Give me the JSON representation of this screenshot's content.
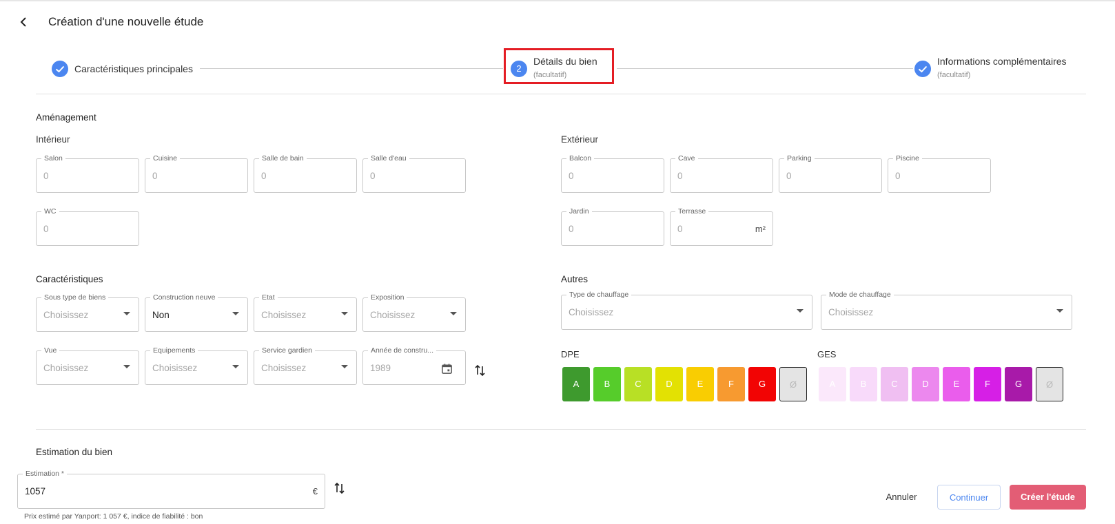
{
  "header": {
    "title": "Création d'une nouvelle étude"
  },
  "stepper": {
    "steps": [
      {
        "label": "Caractéristiques principales",
        "sub": "",
        "state": "done"
      },
      {
        "label": "Détails du bien",
        "sub": "(facultatif)",
        "number": "2",
        "state": "active"
      },
      {
        "label": "Informations complémentaires",
        "sub": "(facultatif)",
        "state": "done"
      }
    ]
  },
  "amenagement": {
    "title": "Aménagement",
    "interieur": {
      "title": "Intérieur",
      "fields": [
        {
          "label": "Salon",
          "value": "0"
        },
        {
          "label": "Cuisine",
          "value": "0"
        },
        {
          "label": "Salle de bain",
          "value": "0"
        },
        {
          "label": "Salle d'eau",
          "value": "0"
        },
        {
          "label": "WC",
          "value": "0"
        }
      ]
    },
    "exterieur": {
      "title": "Extérieur",
      "fields": [
        {
          "label": "Balcon",
          "value": "0"
        },
        {
          "label": "Cave",
          "value": "0"
        },
        {
          "label": "Parking",
          "value": "0"
        },
        {
          "label": "Piscine",
          "value": "0"
        },
        {
          "label": "Jardin",
          "value": "0"
        },
        {
          "label": "Terrasse",
          "value": "0",
          "unit": "m²"
        }
      ]
    }
  },
  "caracteristiques": {
    "title": "Caractéristiques",
    "fields": [
      {
        "label": "Sous type de biens",
        "value": "Choisissez"
      },
      {
        "label": "Construction neuve",
        "value": "Non"
      },
      {
        "label": "Etat",
        "value": "Choisissez"
      },
      {
        "label": "Exposition",
        "value": "Choisissez"
      },
      {
        "label": "Vue",
        "value": "Choisissez"
      },
      {
        "label": "Equipements",
        "value": "Choisissez"
      },
      {
        "label": "Service gardien",
        "value": "Choisissez"
      },
      {
        "label": "Année de constru...",
        "value": "1989"
      }
    ]
  },
  "autres": {
    "title": "Autres",
    "fields": [
      {
        "label": "Type de chauffage",
        "value": "Choisissez"
      },
      {
        "label": "Mode de chauffage",
        "value": "Choisissez"
      }
    ],
    "dpe": {
      "label": "DPE",
      "buttons": [
        {
          "letter": "A",
          "color": "#3e9a2e"
        },
        {
          "letter": "B",
          "color": "#56cc2b"
        },
        {
          "letter": "C",
          "color": "#b8e025"
        },
        {
          "letter": "D",
          "color": "#e3e103"
        },
        {
          "letter": "E",
          "color": "#f9cd02"
        },
        {
          "letter": "F",
          "color": "#f79a30"
        },
        {
          "letter": "G",
          "color": "#f20404"
        },
        {
          "letter": "Ø",
          "color": "#e4e4e4"
        }
      ]
    },
    "ges": {
      "label": "GES",
      "buttons": [
        {
          "letter": "A",
          "color": "#fbe8fb"
        },
        {
          "letter": "B",
          "color": "#f8dafa"
        },
        {
          "letter": "C",
          "color": "#f0bff2"
        },
        {
          "letter": "D",
          "color": "#ec88ee"
        },
        {
          "letter": "E",
          "color": "#ea5dec"
        },
        {
          "letter": "F",
          "color": "#d61fe6"
        },
        {
          "letter": "G",
          "color": "#a81aa9"
        },
        {
          "letter": "Ø",
          "color": "#e4e4e4"
        }
      ]
    }
  },
  "estimation": {
    "title": "Estimation du bien",
    "label": "Estimation *",
    "value": "1057",
    "unit": "€",
    "hint": "Prix estimé par Yanport: 1 057 €, indice de fiabilité : bon"
  },
  "actions": {
    "cancel": "Annuler",
    "continue": "Continuer",
    "create": "Créer l'étude"
  },
  "colors": {
    "accent": "#4b86f0",
    "highlight": "#e41d24",
    "primary_button": "#e35d75"
  }
}
